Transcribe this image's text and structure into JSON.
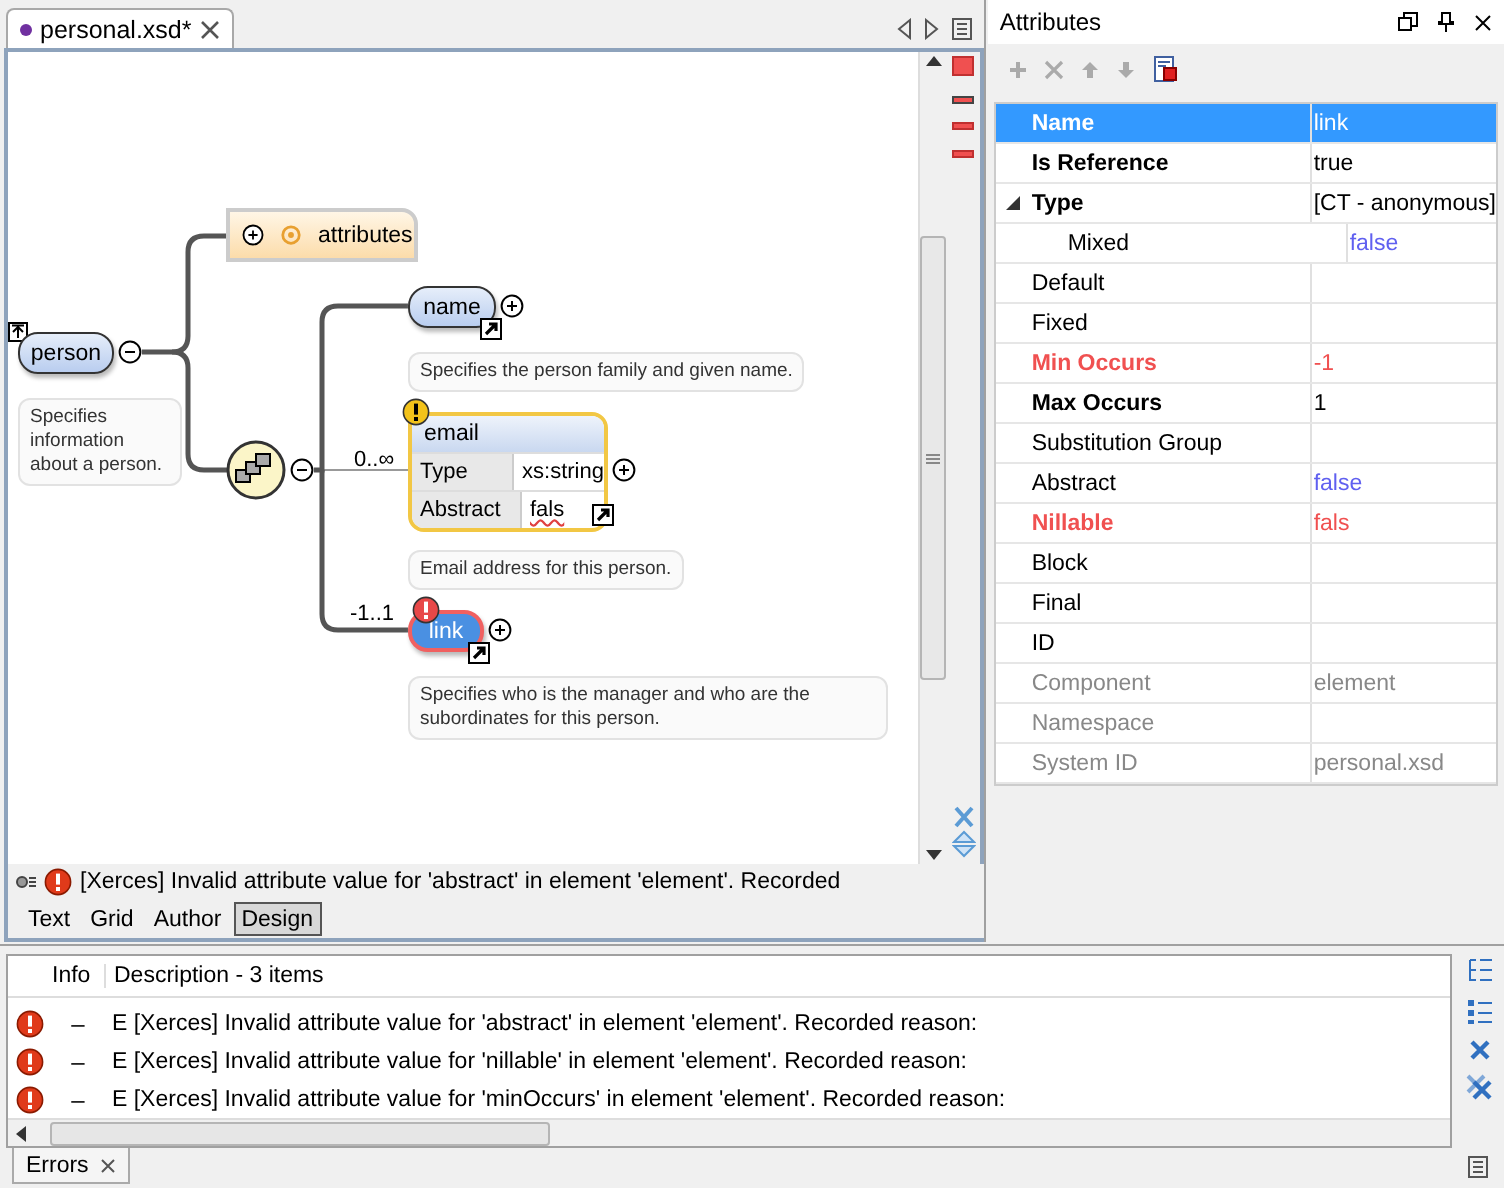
{
  "editor_tab": {
    "label": "personal.xsd*",
    "modified": true
  },
  "diagram": {
    "root": {
      "label": "person",
      "doc": "Specifies information about a person."
    },
    "attributes_node": {
      "label": "attributes"
    },
    "children": [
      {
        "kind": "element",
        "label": "name",
        "warning": false,
        "error": false,
        "selected": false,
        "doc": "Specifies the person family and given name."
      },
      {
        "kind": "element_details",
        "label": "email",
        "occurs": "0..∞",
        "warning": true,
        "error": false,
        "selected": false,
        "details": [
          {
            "label": "Type",
            "value": "xs:string",
            "invalid": false
          },
          {
            "label": "Abstract",
            "value": "fals",
            "invalid": true
          }
        ],
        "doc": "Email address for this person."
      },
      {
        "kind": "element",
        "label": "link",
        "occurs": "-1..1",
        "warning": false,
        "error": true,
        "selected": true,
        "doc": "Specifies who is the manager and who are the subordinates for this person."
      }
    ]
  },
  "message": "[Xerces]  Invalid attribute value for 'abstract' in element 'element'. Recorded",
  "mode_tabs": [
    {
      "label": "Text",
      "selected": false
    },
    {
      "label": "Grid",
      "selected": false
    },
    {
      "label": "Author",
      "selected": false
    },
    {
      "label": "Design",
      "selected": true
    }
  ],
  "attributes_panel": {
    "title": "Attributes",
    "rows": [
      {
        "name": "Name",
        "value": "link",
        "kind": "bold",
        "selected": true,
        "default_value": false
      },
      {
        "name": "Is Reference",
        "value": "true",
        "kind": "bold",
        "selected": false,
        "default_value": false
      },
      {
        "name": "Type",
        "value": "[CT - anonymous]",
        "kind": "bold",
        "selected": false,
        "default_value": false,
        "expanded": true,
        "children": [
          {
            "name": "Mixed",
            "value": "false",
            "kind": "plain",
            "selected": false,
            "default_value": true
          }
        ]
      },
      {
        "name": "Default",
        "kind": "plain",
        "selected": false
      },
      {
        "name": "Fixed",
        "kind": "plain",
        "selected": false
      },
      {
        "name": "Min Occurs",
        "value": "-1",
        "kind": "error",
        "selected": false
      },
      {
        "name": "Max Occurs",
        "value": "1",
        "kind": "bold",
        "selected": false,
        "default_value": false
      },
      {
        "name": "Substitution Group",
        "kind": "plain",
        "selected": false
      },
      {
        "name": "Abstract",
        "value": "false",
        "kind": "plain",
        "selected": false,
        "default_value": true
      },
      {
        "name": "Nillable",
        "value": "fals",
        "kind": "error",
        "selected": false
      },
      {
        "name": "Block",
        "kind": "plain",
        "selected": false
      },
      {
        "name": "Final",
        "kind": "plain",
        "selected": false
      },
      {
        "name": "ID",
        "kind": "plain",
        "selected": false
      },
      {
        "name": "Component",
        "value": "element",
        "kind": "readonly",
        "selected": false
      },
      {
        "name": "Namespace",
        "kind": "readonly",
        "selected": false
      },
      {
        "name": "System ID",
        "value": "personal.xsd",
        "kind": "readonly",
        "selected": false
      }
    ]
  },
  "problems": {
    "columns": [
      "Info",
      "Description - 3 items"
    ],
    "rows": [
      {
        "info": "–",
        "description": "E [Xerces]  Invalid attribute value for 'abstract' in element 'element'. Recorded reason:"
      },
      {
        "info": "–",
        "description": "E [Xerces]  Invalid attribute value for 'nillable' in element 'element'. Recorded reason:"
      },
      {
        "info": "–",
        "description": "E [Xerces]  Invalid attribute value for 'minOccurs' in element 'element'. Recorded reason:"
      }
    ]
  },
  "bottom_tab": {
    "label": "Errors"
  }
}
